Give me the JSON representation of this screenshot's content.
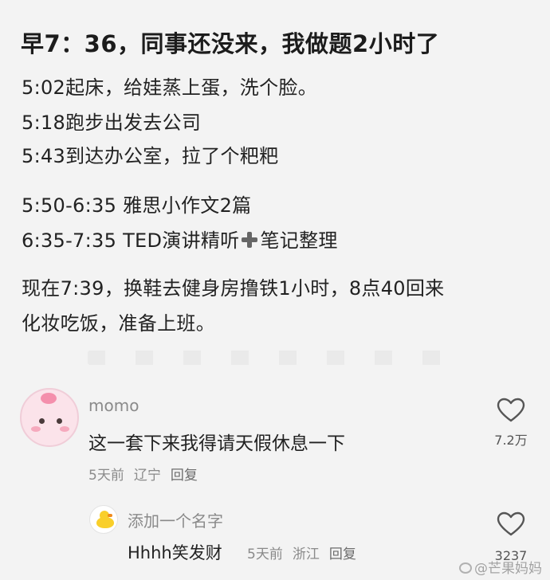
{
  "post": {
    "title": "早7：36，同事还没来，我做题2小时了",
    "lines": [
      "5:02起床，给娃蒸上蛋，洗个脸。",
      "5:18跑步出发去公司",
      "5:43到达办公室，拉了个粑粑",
      "5:50-6:35  雅思小作文2篇",
      "6:35-7:35  TED演讲精听",
      "笔记整理",
      "现在7:39，换鞋去健身房撸铁1小时，8点40回来",
      "化妆吃饭，准备上班。"
    ]
  },
  "comments": [
    {
      "username": "momo",
      "text": "这一套下来我得请天假休息一下",
      "time": "5天前",
      "location": "辽宁",
      "reply_label": "回复",
      "likes": "7.2万",
      "avatar_icon": "pink-creature-avatar"
    },
    {
      "username": "添加一个名字",
      "text": "Hhhh笑发财",
      "time": "5天前",
      "location": "浙江",
      "reply_label": "回复",
      "likes": "3237",
      "avatar_icon": "duck-avatar"
    }
  ],
  "watermark": "@芒果妈妈",
  "colors": {
    "background": "#f3f3f3",
    "text": "#222222",
    "meta": "#8a8a8a"
  }
}
